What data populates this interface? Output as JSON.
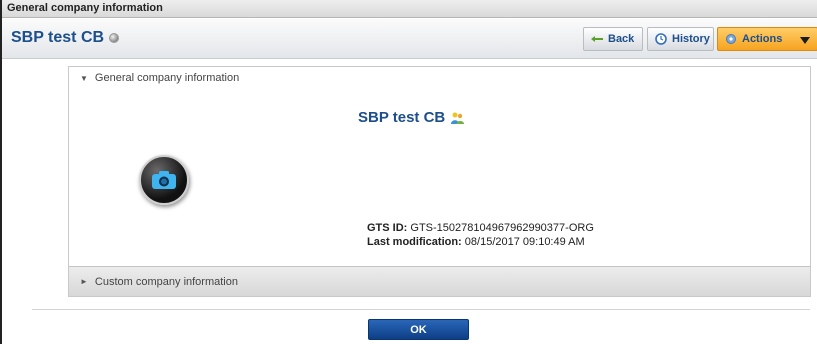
{
  "window": {
    "title": "General company information"
  },
  "header": {
    "title": "SBP test CB",
    "buttons": {
      "back": "Back",
      "history": "History",
      "actions": "Actions"
    }
  },
  "general_section": {
    "label": "General company information",
    "company_name": "SBP test CB",
    "gts_id_label": "GTS ID:",
    "gts_id_value": "GTS-150278104967962990377-ORG",
    "last_mod_label": "Last modification:",
    "last_mod_value": "08/15/2017 09:10:49 AM"
  },
  "custom_section": {
    "label": "Custom company information"
  },
  "footer": {
    "ok_label": "OK"
  },
  "icons": [
    "status-icon",
    "back-arrow-icon",
    "history-icon",
    "actions-icon",
    "chevron-down-icon",
    "people-icon",
    "camera-icon"
  ],
  "colors": {
    "title_blue": "#1d4f8d",
    "actions_orange": "#f6a31f",
    "ok_blue": "#1b4f9c"
  }
}
